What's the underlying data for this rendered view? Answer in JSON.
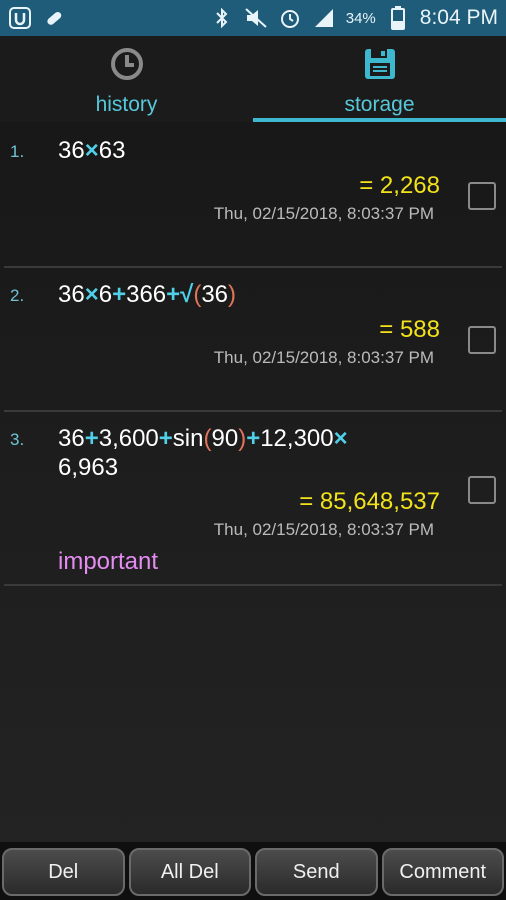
{
  "status_bar": {
    "battery": "34%",
    "time": "8:04 PM",
    "icons": [
      "app-icon",
      "pill-icon",
      "bluetooth-icon",
      "mute-icon",
      "alarm-icon",
      "signal-icon",
      "battery-icon"
    ]
  },
  "tabs": [
    {
      "label": "history",
      "icon": "clock-icon",
      "selected": false
    },
    {
      "label": "storage",
      "icon": "floppy-disk-icon",
      "selected": true
    }
  ],
  "items": [
    {
      "num": "1.",
      "expr_parts": [
        [
          "n",
          "36"
        ],
        [
          "op",
          "×"
        ],
        [
          "n",
          "63"
        ]
      ],
      "result": "= 2,268",
      "date": "Thu, 02/15/2018, 8:03:37 PM",
      "comment": ""
    },
    {
      "num": "2.",
      "expr_parts": [
        [
          "n",
          "36"
        ],
        [
          "op",
          "×"
        ],
        [
          "n",
          "6"
        ],
        [
          "op",
          "+"
        ],
        [
          "n",
          "366"
        ],
        [
          "op",
          "+"
        ],
        [
          "op",
          "√"
        ],
        [
          "p",
          "("
        ],
        [
          "n",
          "36"
        ],
        [
          "p",
          ")"
        ]
      ],
      "result": "= 588",
      "date": "Thu, 02/15/2018, 8:03:37 PM",
      "comment": ""
    },
    {
      "num": "3.",
      "expr_parts": [
        [
          "n",
          "36"
        ],
        [
          "op",
          "+"
        ],
        [
          "n",
          "3,600"
        ],
        [
          "op",
          "+"
        ],
        [
          "n",
          "sin"
        ],
        [
          "p",
          "("
        ],
        [
          "n",
          "90"
        ],
        [
          "p",
          ")"
        ],
        [
          "op",
          "+"
        ],
        [
          "n",
          "12,300"
        ],
        [
          "op",
          "×"
        ],
        [
          "br",
          ""
        ],
        [
          "n",
          "6,963"
        ]
      ],
      "result": "= 85,648,537",
      "date": "Thu, 02/15/2018, 8:03:37 PM",
      "comment": "important"
    }
  ],
  "buttons": [
    "Del",
    "All Del",
    "Send",
    "Comment"
  ],
  "colors": {
    "status_bar": "#1f5c7a",
    "tab_text": "#56c8da",
    "operator": "#4fd0e8",
    "paren": "#e0745a",
    "result": "#f2e21a",
    "comment": "#e48cf2"
  }
}
